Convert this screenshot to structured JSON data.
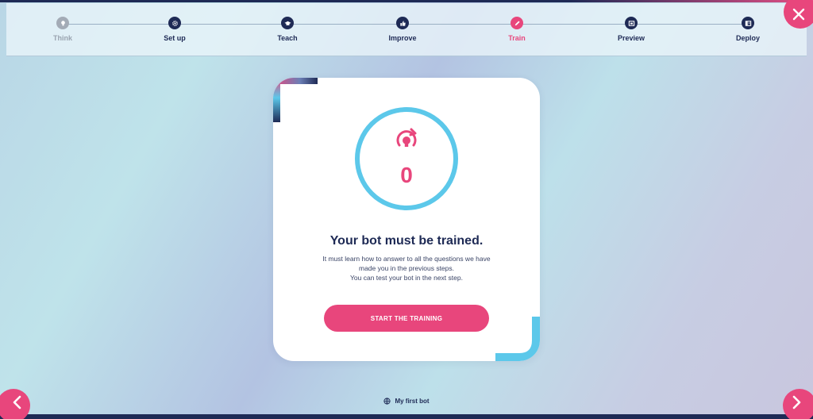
{
  "colors": {
    "accent": "#e8467c",
    "navy": "#1e2a55",
    "ring": "#5cc8ea",
    "disabled": "#a3abb6"
  },
  "stepper": {
    "steps": [
      {
        "label": "Think",
        "state": "disabled",
        "icon": "lightbulb-icon"
      },
      {
        "label": "Set up",
        "state": "done",
        "icon": "gear-icon"
      },
      {
        "label": "Teach",
        "state": "done",
        "icon": "graduation-cap-icon"
      },
      {
        "label": "Improve",
        "state": "done",
        "icon": "thumbs-up-icon"
      },
      {
        "label": "Train",
        "state": "active",
        "icon": "pencil-icon"
      },
      {
        "label": "Preview",
        "state": "todo",
        "icon": "preview-window-icon"
      },
      {
        "label": "Deploy",
        "state": "todo",
        "icon": "deploy-icon"
      }
    ]
  },
  "card": {
    "counter": "0",
    "title": "Your bot must be trained.",
    "description": [
      "It must learn how to answer to all the questions we have",
      "made you in the previous steps.",
      "You can test your bot in the next step."
    ],
    "start_button": "START THE TRAINING"
  },
  "footer": {
    "bot_name": "My first bot"
  },
  "icons": {
    "close": "close-icon",
    "prev": "chevron-left-icon",
    "next": "chevron-right-icon"
  }
}
